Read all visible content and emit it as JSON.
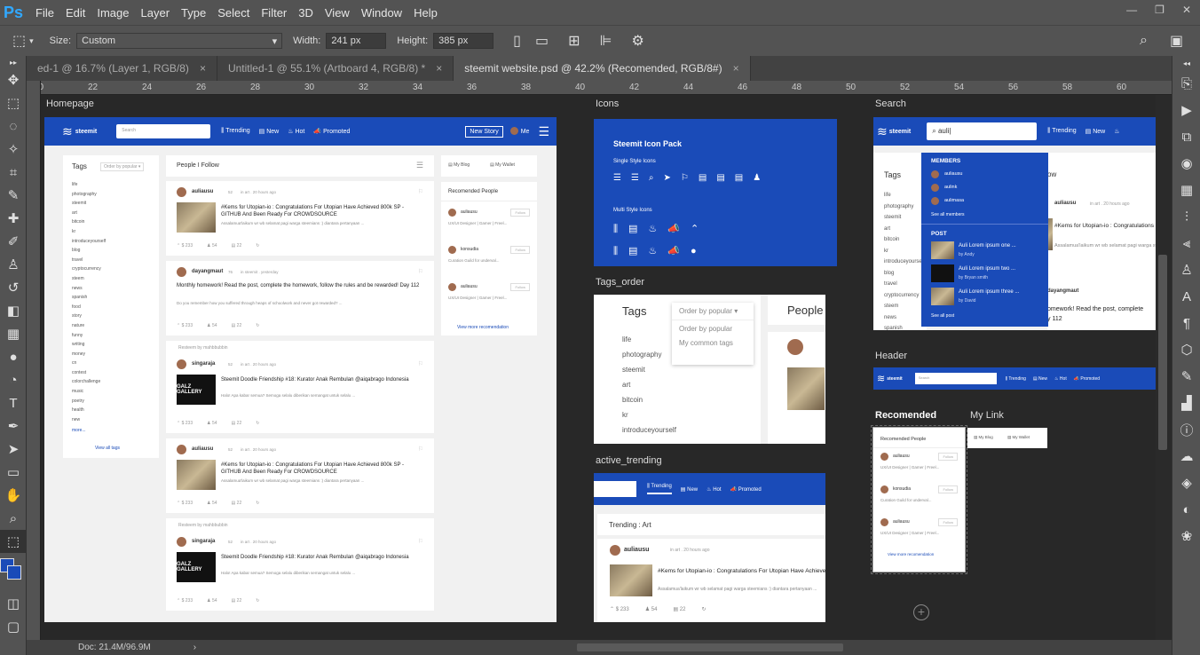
{
  "app": {
    "logo": "Ps"
  },
  "menu": [
    "File",
    "Edit",
    "Image",
    "Layer",
    "Type",
    "Select",
    "Filter",
    "3D",
    "View",
    "Window",
    "Help"
  ],
  "window_controls": [
    "—",
    "❐",
    "✕"
  ],
  "options": {
    "size_label": "Size:",
    "size_value": "Custom",
    "width_label": "Width:",
    "width_value": "241 px",
    "height_label": "Height:",
    "height_value": "385 px"
  },
  "tabs": [
    {
      "label": "ed-1 @ 16.7% (Layer 1, RGB/8)",
      "active": false
    },
    {
      "label": "Untitled-1 @ 55.1% (Artboard 4, RGB/8) *",
      "active": false
    },
    {
      "label": "steemit website.psd @ 42.2% (Recomended, RGB/8#)",
      "active": true
    }
  ],
  "tab_close": "×",
  "ruler": [
    "20",
    "22",
    "24",
    "26",
    "28",
    "30",
    "32",
    "34",
    "36",
    "38",
    "40",
    "42",
    "44",
    "46",
    "48",
    "50",
    "52",
    "54",
    "56",
    "58",
    "60"
  ],
  "status": {
    "doc": "Doc: 21.4M/96.9M"
  },
  "artboards": {
    "homepage": "Homepage",
    "icons": "Icons",
    "search": "Search",
    "tags_order": "Tags_order",
    "header": "Header",
    "active_trending": "active_trending",
    "recomended": "Recomended",
    "my_link": "My Link"
  },
  "site": {
    "brand": "steemit",
    "search_placeholder": "Search",
    "nav": [
      "Trending",
      "New",
      "Hot",
      "Promoted"
    ],
    "new_story": "New Story",
    "me": "Me",
    "tags_title": "Tags",
    "order_select": "Order by popular",
    "tags": [
      "life",
      "photography",
      "steemit",
      "art",
      "bitcoin",
      "kr",
      "introduceyourself",
      "blog",
      "travel",
      "cryptocurrency",
      "steem",
      "news",
      "spanish",
      "food",
      "story",
      "nature",
      "funny",
      "writing",
      "money",
      "cn",
      "contest",
      "colorchallenge",
      "music",
      "poetry",
      "health",
      "new"
    ],
    "more": "more...",
    "view_all_tags": "View all tags",
    "people_i_follow": "People I Follow",
    "my_blog": "My Blog",
    "my_wallet": "My Wallet",
    "recommended_people": "Recomended People",
    "view_more": "View more recomendation",
    "follow": "Follow",
    "people": [
      {
        "name": "auliausu",
        "desc": "UX/UI Designer | Gamer | Freel..."
      },
      {
        "name": "konsudia",
        "desc": "Curation Guild for underval..."
      },
      {
        "name": "auliausu",
        "desc": "UX/UI Designer | Gamer | Freel..."
      }
    ],
    "posts": [
      {
        "author": "auliausu",
        "rep": "52",
        "meta": "in art . 20 hours ago",
        "title": "#Kems for Utopian-io : Congratulations For Utopian Have Achieved 800k SP - GITHUB And Been Ready For CROWDSOURCE",
        "excerpt": "Assalamua'laikum wr wb selamat pagi warga steemians :) diantara pertanyaan ...",
        "value": "$ 233",
        "votes": "54",
        "comments": "22",
        "resteemed": ""
      },
      {
        "author": "dayangmaut",
        "rep": "76",
        "meta": "in steemit . yesterday",
        "title": "Monthly homework! Read the post, complete the homework, follow the rules and be rewarded! Day 112",
        "excerpt": "Do you remember how you suffered through heaps of schoolwork and never got rewarded? ...",
        "value": "$ 233",
        "votes": "54",
        "comments": "22",
        "resteemed": ""
      },
      {
        "author": "singaraja",
        "rep": "52",
        "meta": "in art . 20 hours ago",
        "title": "Steemit Doodle Friendship #18: Kurator Anak Rembulan @aiqabrago Indonesia",
        "excerpt": "Halo! Apa kabar semua? Semoga selalu diberikan semangat untuk selalu ...",
        "value": "$ 233",
        "votes": "54",
        "comments": "22",
        "resteemed": "Resteem by mahbbubbin"
      },
      {
        "author": "auliausu",
        "rep": "52",
        "meta": "in art . 20 hours ago",
        "title": "#Kems for Utopian-io : Congratulations For Utopian Have Achieved 800k SP - GITHUB And Been Ready For CROWDSOURCE",
        "excerpt": "Assalamua'laikum wr wb selamat pagi warga steemians :) diantara pertanyaan ...",
        "value": "$ 233",
        "votes": "54",
        "comments": "22",
        "resteemed": ""
      },
      {
        "author": "singaraja",
        "rep": "52",
        "meta": "in art . 20 hours ago",
        "title": "Steemit Doodle Friendship #18: Kurator Anak Rembulan @aiqabrago Indonesia",
        "excerpt": "Halo! Apa kabar semua? Semoga selalu diberikan semangat untuk selalu ...",
        "value": "$ 233",
        "votes": "54",
        "comments": "22",
        "resteemed": "Resteem by mahbbubbin"
      }
    ],
    "gallery_text": "GALZ GALLERY",
    "icon_pack_title": "Steemit Icon Pack",
    "single_style": "Single Style Icons",
    "multi_style": "Multi Style Icons",
    "search_query": "auli",
    "members_title": "MEMBERS",
    "members": [
      "auliausu",
      "aulink",
      "aulimasa"
    ],
    "see_all_members": "See all members",
    "post_title": "POST",
    "search_posts": [
      {
        "title": "Auli Lorem ipsum one ...",
        "by": "by Andy"
      },
      {
        "title": "Auli Lorem ipsum two ...",
        "by": "by Bryan smith"
      },
      {
        "title": "Auli Lorem ipsum three ...",
        "by": "by David"
      }
    ],
    "see_all_post": "See all post",
    "order_options": [
      "Order by popular",
      "My common tags"
    ],
    "people_label": "People",
    "trending_art": "Trending : Art",
    "dash_text": "ow",
    "homework_snip": "omework! Read the post, complete",
    "day_snip": "y 112"
  },
  "colors": {
    "steemit_blue": "#1a4bb8",
    "ps_bg": "#282828",
    "ps_panel": "#535353"
  }
}
